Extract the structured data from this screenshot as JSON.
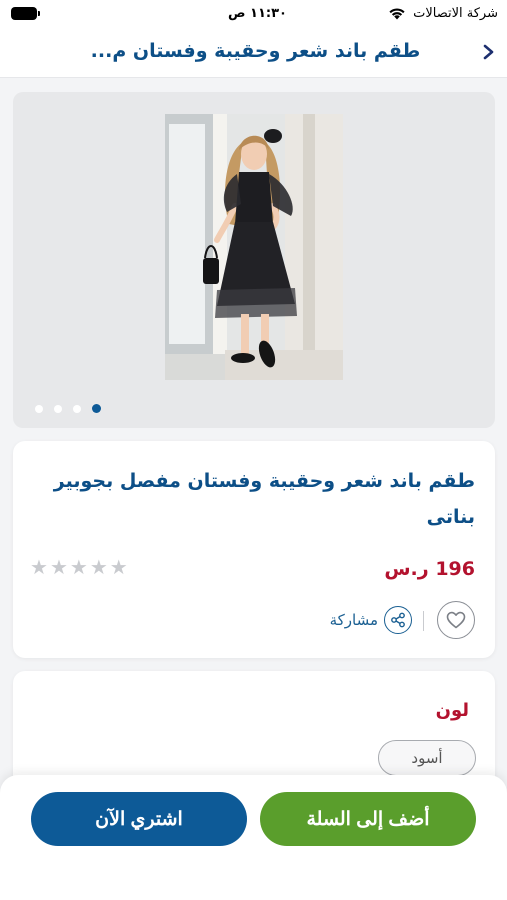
{
  "status_bar": {
    "carrier": "شركة الاتصالات",
    "time": "١١:٣٠ ص"
  },
  "header": {
    "title": "طقم باند شعر وحقيبة وفستان م...",
    "back_icon": "chevron-right-icon"
  },
  "gallery": {
    "image_count": 4,
    "active_index": 3
  },
  "product": {
    "title": "طقم باند شعر وحقيبة وفستان مفصل بجوبير بناتى",
    "price": "196 ر.س",
    "rating": 0,
    "rating_max": 5,
    "share_label": "مشاركة",
    "favorite_icon": "heart-icon",
    "share_icon": "share-icon"
  },
  "options": {
    "color_label": "لون",
    "selected_color": "أسود"
  },
  "actions": {
    "add_to_cart": "أضف إلى السلة",
    "buy_now": "اشتري الآن"
  },
  "colors": {
    "brand_blue": "#0d4f87",
    "price_red": "#b3122e",
    "cart_green": "#5a9e2c",
    "buy_blue": "#0d5a97"
  }
}
